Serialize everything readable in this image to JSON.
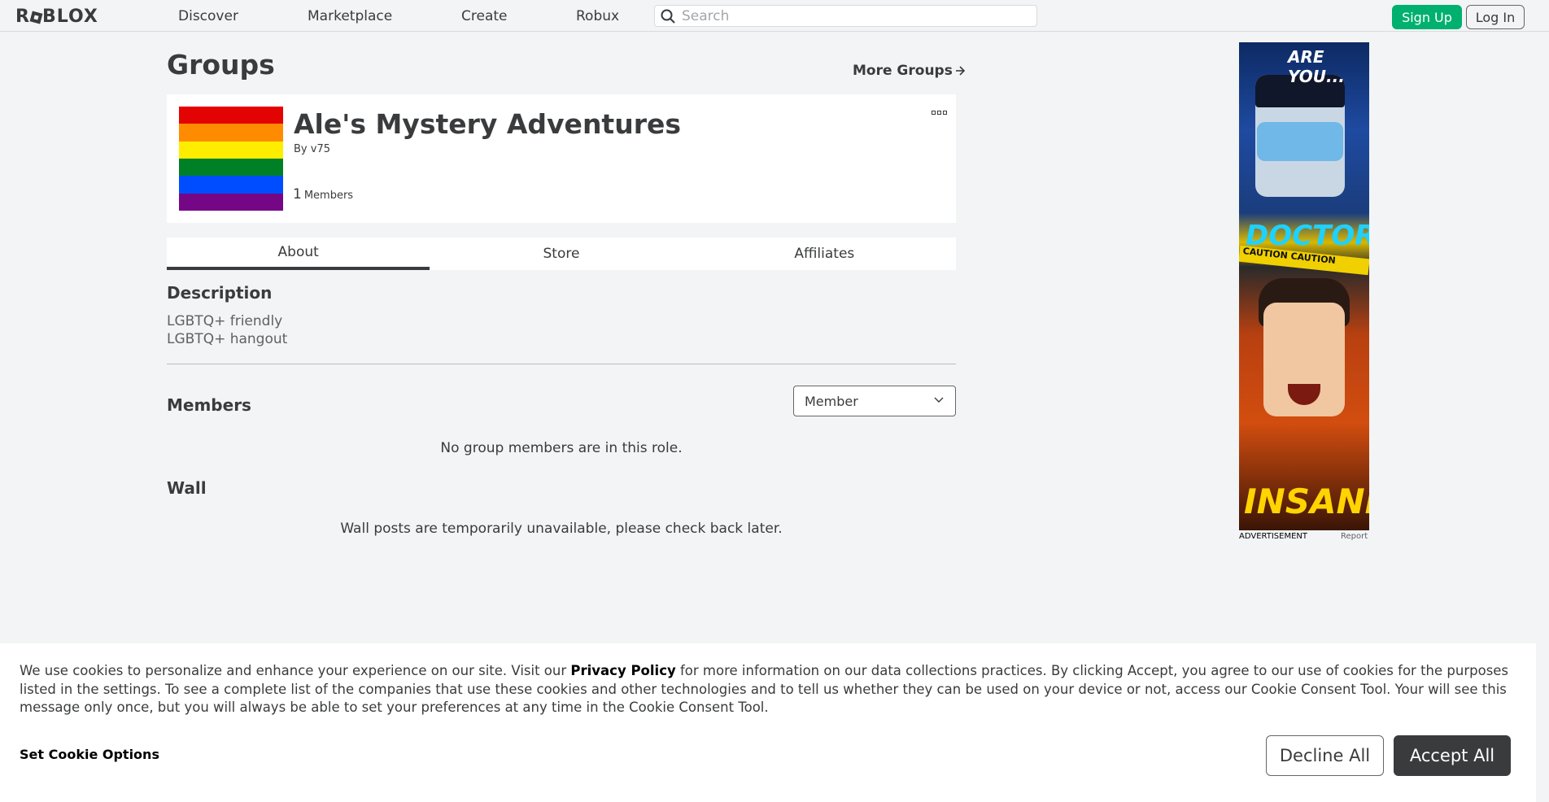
{
  "nav": {
    "logo": "ROBLOX",
    "links": [
      "Discover",
      "Marketplace",
      "Create",
      "Robux"
    ],
    "search_placeholder": "Search",
    "signup": "Sign Up",
    "login": "Log In"
  },
  "page": {
    "title": "Groups",
    "more_groups": "More Groups"
  },
  "group": {
    "name": "Ale's Mystery Adventures",
    "owner": "By v75",
    "member_count": "1",
    "member_label": "Members",
    "emblem_colors": [
      "#e40303",
      "#ff8c00",
      "#ffed00",
      "#008026",
      "#004dff",
      "#750787"
    ]
  },
  "tabs": [
    "About",
    "Store",
    "Affiliates"
  ],
  "about": {
    "description_heading": "Description",
    "description_lines": [
      "LGBTQ+ friendly",
      "LGBTQ+ hangout"
    ],
    "members_heading": "Members",
    "role_selected": "Member",
    "members_empty": "No group members are in this role.",
    "wall_heading": "Wall",
    "wall_message": "Wall posts are temporarily unavailable, please check back later."
  },
  "ad": {
    "headline1": "ARE YOU...",
    "headline2": "DOCTOR?",
    "caution": "CAUTION   CAUTION",
    "headline3": "INSANE?",
    "label": "ADVERTISEMENT",
    "report": "Report"
  },
  "cookie": {
    "text_before": "We use cookies to personalize and enhance your experience on our site. Visit our ",
    "policy_link": "Privacy Policy",
    "text_after": " for more information on our data collections practices. By clicking Accept, you agree to our use of cookies for the purposes listed in the settings. To see a complete list of the companies that use these cookies and other technologies and to tell us whether they can be used on your device or not, access our Cookie Consent Tool. Your will see this message only once, but you will always be able to set your preferences at any time in the Cookie Consent Tool.",
    "set_options": "Set Cookie Options",
    "decline": "Decline All",
    "accept": "Accept All"
  }
}
